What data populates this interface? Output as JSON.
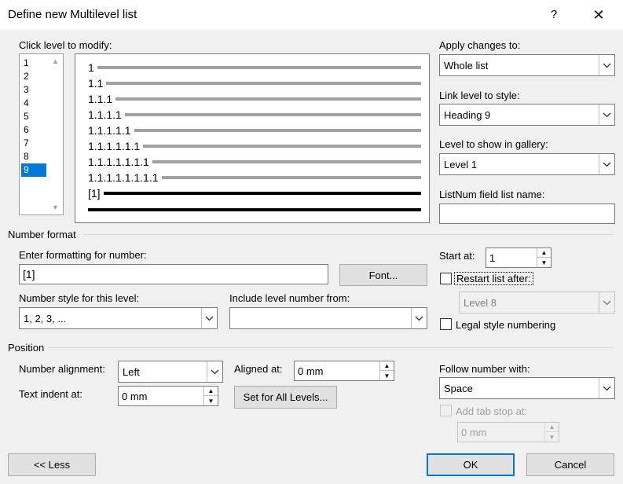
{
  "window": {
    "title": "Define new Multilevel list",
    "help": "?",
    "close": "✕"
  },
  "levels": {
    "label": "Click level to modify:",
    "items": [
      "1",
      "2",
      "3",
      "4",
      "5",
      "6",
      "7",
      "8",
      "9"
    ],
    "selected": "9"
  },
  "preview": {
    "rows": [
      "1",
      "1.1",
      "1.1.1",
      "1.1.1.1",
      "1.1.1.1.1",
      "1.1.1.1.1.1",
      "1.1.1.1.1.1.1",
      "1.1.1.1.1.1.1.1",
      "[1]"
    ]
  },
  "apply": {
    "label": "Apply changes to:",
    "value": "Whole list"
  },
  "link_style": {
    "label": "Link level to style:",
    "value": "Heading 9"
  },
  "gallery": {
    "label": "Level to show in gallery:",
    "value": "Level 1"
  },
  "listnum": {
    "label": "ListNum field list name:",
    "value": ""
  },
  "number_format": {
    "section": "Number format",
    "enter_label": "Enter formatting for number:",
    "enter_value": "[1]",
    "font_button": "Font...",
    "style_label": "Number style for this level:",
    "style_value": "1, 2, 3, ...",
    "include_label": "Include level number from:",
    "include_value": "",
    "start_label": "Start at:",
    "start_value": "1",
    "restart_label": "Restart list after:",
    "restart_value": "Level 8",
    "legal_label": "Legal style numbering"
  },
  "position": {
    "section": "Position",
    "alignment_label": "Number alignment:",
    "alignment_value": "Left",
    "aligned_label": "Aligned at:",
    "aligned_value": "0 mm",
    "indent_label": "Text indent at:",
    "indent_value": "0 mm",
    "set_all_button": "Set for All Levels...",
    "follow_label": "Follow number with:",
    "follow_value": "Space",
    "tabstop_label": "Add tab stop at:",
    "tabstop_value": "0 mm"
  },
  "footer": {
    "less": "<< Less",
    "ok": "OK",
    "cancel": "Cancel"
  },
  "colors": {
    "selection": "#0078d7",
    "background": "#f0f0f0"
  }
}
